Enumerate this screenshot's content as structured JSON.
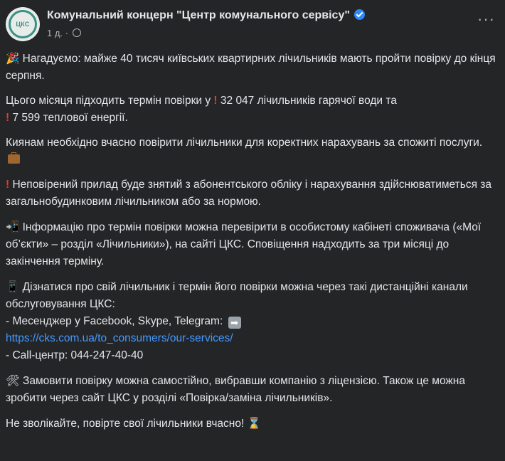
{
  "post": {
    "author": "Комунальний концерн \"Центр комунального сервісу\"",
    "avatar_text": "ЦКС",
    "time": "1 д. ·",
    "more_label": "···"
  },
  "paragraphs": {
    "p1": "Нагадуємо: майже 40 тисяч київських квартирних лічильників мають пройти повірку до кінця серпня.",
    "p2a": "Цього місяця  підходить термін повірки у",
    "p2b": "32 047 лічильників гарячої води та",
    "p2c": "7 599 теплової енергії.",
    "p3": "Киянам необхідно вчасно повірити лічильники для коректних нарахувань за спожиті послуги.",
    "p4": "Неповірений прилад буде знятий з абонентського обліку і нарахування здійснюватиметься за загальнобудинковим лічильником або за нормою.",
    "p5": "Інформацію про термін повірки можна перевірити в особистому кабінеті споживача («Мої об’єкти» – розділ «Лічильники»), на сайті ЦКС. Сповіщення надходить за три місяці до закінчення терміну.",
    "p6a": "Дізнатися про свій лічильник і термін його повірки можна через такі дистанційні канали обслуговування ЦКС:",
    "p6b": "- Месенджер у Facebook, Skype, Telegram:",
    "p6_link": "https://cks.com.ua/to_consumers/our-services/",
    "p6c": "- Call-центр: 044-247-40-40",
    "p7": "Замовити повірку можна самостійно, вибравши компанію з ліцензією. Також це можна зробити через сайт ЦКС у розділі «Повірка/заміна лічильників».",
    "p8": "Не зволікайте, повірте свої лічильники вчасно!"
  },
  "icons": {
    "p1": "party-popper-icon",
    "p2": "red-exclamation-icon",
    "p3": "briefcase-icon",
    "p4": "red-exclamation-icon",
    "p5": "mobile-arrow-icon",
    "p6": "mobile-phone-icon",
    "p6b": "right-arrow-icon",
    "p7": "hammer-wrench-icon",
    "p8": "hourglass-icon"
  },
  "colors": {
    "background": "#242526",
    "text": "#e4e6eb",
    "secondary_text": "#b0b3b8",
    "link": "#4599ff",
    "verified": "#2d88ff"
  }
}
